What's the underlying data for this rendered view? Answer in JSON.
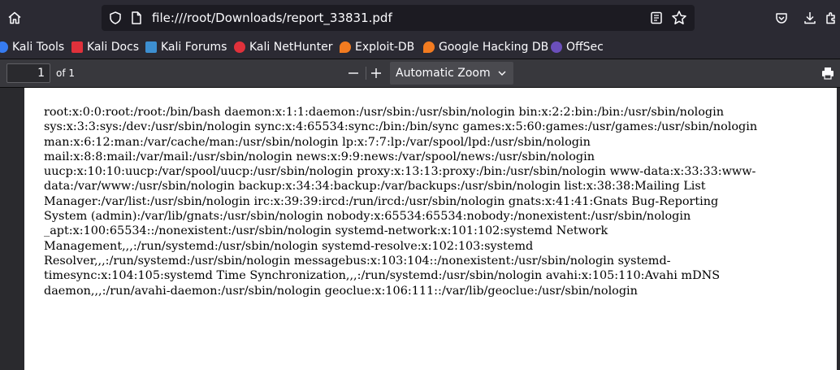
{
  "browser": {
    "url": "file:///root/Downloads/report_33831.pdf"
  },
  "bookmarks": [
    {
      "label": "Kali Tools",
      "icon": "kali-tools-icon",
      "color": "#367bf0"
    },
    {
      "label": "Kali Docs",
      "icon": "kali-docs-icon",
      "color": "#e0313b"
    },
    {
      "label": "Kali Forums",
      "icon": "kali-forums-icon",
      "color": "#3d8fd1"
    },
    {
      "label": "Kali NetHunter",
      "icon": "kali-nethunter-icon",
      "color": "#e0313b"
    },
    {
      "label": "Exploit-DB",
      "icon": "exploit-db-icon",
      "color": "#f27b20"
    },
    {
      "label": "Google Hacking DB",
      "icon": "ghdb-icon",
      "color": "#f27b20"
    },
    {
      "label": "OffSec",
      "icon": "offsec-icon",
      "color": "#6b4fbb"
    }
  ],
  "pdf_toolbar": {
    "page_number": "1",
    "page_count": "of 1",
    "zoom": "Automatic Zoom"
  },
  "document": {
    "lines": [
      "root:x:0:0:root:/root:/bin/bash daemon:x:1:1:daemon:/usr/sbin:/usr/sbin/nologin bin:x:2:2:bin:/bin:/usr/sbin/nologin",
      "sys:x:3:3:sys:/dev:/usr/sbin/nologin sync:x:4:65534:sync:/bin:/bin/sync games:x:5:60:games:/usr/games:/usr/sbin/nologin",
      "man:x:6:12:man:/var/cache/man:/usr/sbin/nologin lp:x:7:7:lp:/var/spool/lpd:/usr/sbin/nologin",
      "mail:x:8:8:mail:/var/mail:/usr/sbin/nologin news:x:9:9:news:/var/spool/news:/usr/sbin/nologin",
      "uucp:x:10:10:uucp:/var/spool/uucp:/usr/sbin/nologin proxy:x:13:13:proxy:/bin:/usr/sbin/nologin www-data:x:33:33:www-",
      "data:/var/www:/usr/sbin/nologin backup:x:34:34:backup:/var/backups:/usr/sbin/nologin list:x:38:38:Mailing List",
      "Manager:/var/list:/usr/sbin/nologin irc:x:39:39:ircd:/run/ircd:/usr/sbin/nologin gnats:x:41:41:Gnats Bug-Reporting",
      "System (admin):/var/lib/gnats:/usr/sbin/nologin nobody:x:65534:65534:nobody:/nonexistent:/usr/sbin/nologin",
      "_apt:x:100:65534::/nonexistent:/usr/sbin/nologin systemd-network:x:101:102:systemd Network",
      "Management,,,:/run/systemd:/usr/sbin/nologin systemd-resolve:x:102:103:systemd",
      "Resolver,,,:/run/systemd:/usr/sbin/nologin messagebus:x:103:104::/nonexistent:/usr/sbin/nologin systemd-",
      "timesync:x:104:105:systemd Time Synchronization,,,:/run/systemd:/usr/sbin/nologin avahi:x:105:110:Avahi mDNS",
      "daemon,,,:/run/avahi-daemon:/usr/sbin/nologin geoclue:x:106:111::/var/lib/geoclue:/usr/sbin/nologin"
    ]
  }
}
